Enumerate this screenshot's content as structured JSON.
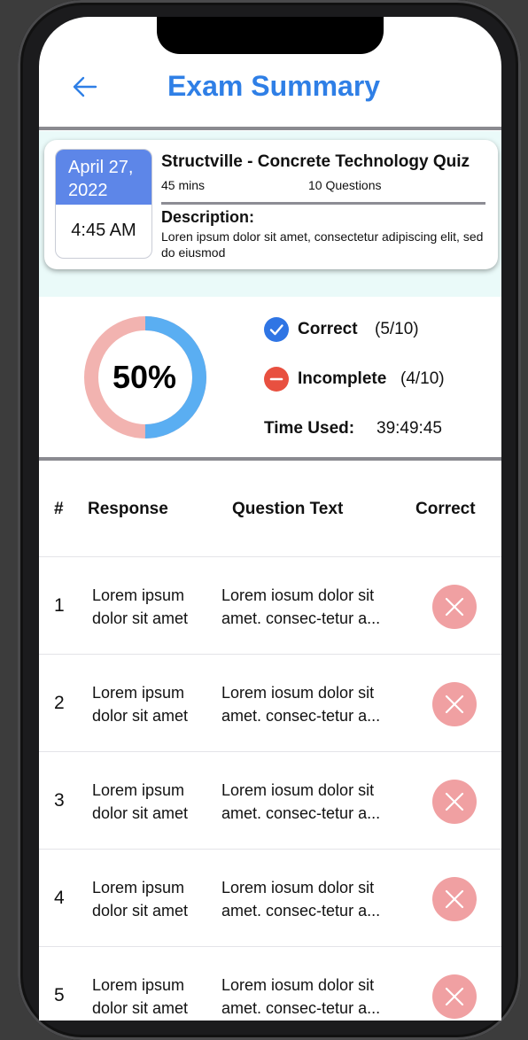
{
  "header": {
    "back_icon": "arrow-left-icon",
    "title": "Exam Summary"
  },
  "exam": {
    "date_line1": "April 27,",
    "date_line2": "2022",
    "time": "4:45 AM",
    "title": "Structville - Concrete Technology Quiz",
    "duration": "45 mins",
    "questions": "10 Questions",
    "description_label": "Description:",
    "description": "Loren ipsum dolor sit amet, consectetur adipiscing elit, sed do eiusmod"
  },
  "stats": {
    "percent_label": "50%",
    "percent_value": 0.5,
    "correct_color": "#5aaef2",
    "remaining_color": "#f2b3b0",
    "correct_label": "Correct",
    "correct_value": "(5/10)",
    "incomplete_label": "Incomplete",
    "incomplete_value": "(4/10)",
    "time_label": "Time Used:",
    "time_value": "39:49:45"
  },
  "table": {
    "headers": {
      "num": "#",
      "response": "Response",
      "question": "Question Text",
      "correct": "Correct"
    },
    "rows": [
      {
        "num": "1",
        "response_1": "Lorem ipsum",
        "response_2": "dolor sit amet",
        "question_1": "Lorem iosum dolor sit",
        "question_2": "amet. consec-tetur a...",
        "status_icon": "close-icon"
      },
      {
        "num": "2",
        "response_1": "Lorem ipsum",
        "response_2": "dolor sit amet",
        "question_1": "Lorem iosum dolor sit",
        "question_2": "amet. consec-tetur a...",
        "status_icon": "close-icon"
      },
      {
        "num": "3",
        "response_1": "Lorem ipsum",
        "response_2": "dolor sit amet",
        "question_1": "Lorem iosum dolor sit",
        "question_2": "amet. consec-tetur a...",
        "status_icon": "close-icon"
      },
      {
        "num": "4",
        "response_1": "Lorem ipsum",
        "response_2": "dolor sit amet",
        "question_1": "Lorem iosum dolor sit",
        "question_2": "amet. consec-tetur a...",
        "status_icon": "close-icon"
      },
      {
        "num": "5",
        "response_1": "Lorem ipsum",
        "response_2": "dolor sit amet",
        "question_1": "Lorem iosum dolor sit",
        "question_2": "amet. consec-tetur a...",
        "status_icon": "close-icon"
      }
    ]
  }
}
